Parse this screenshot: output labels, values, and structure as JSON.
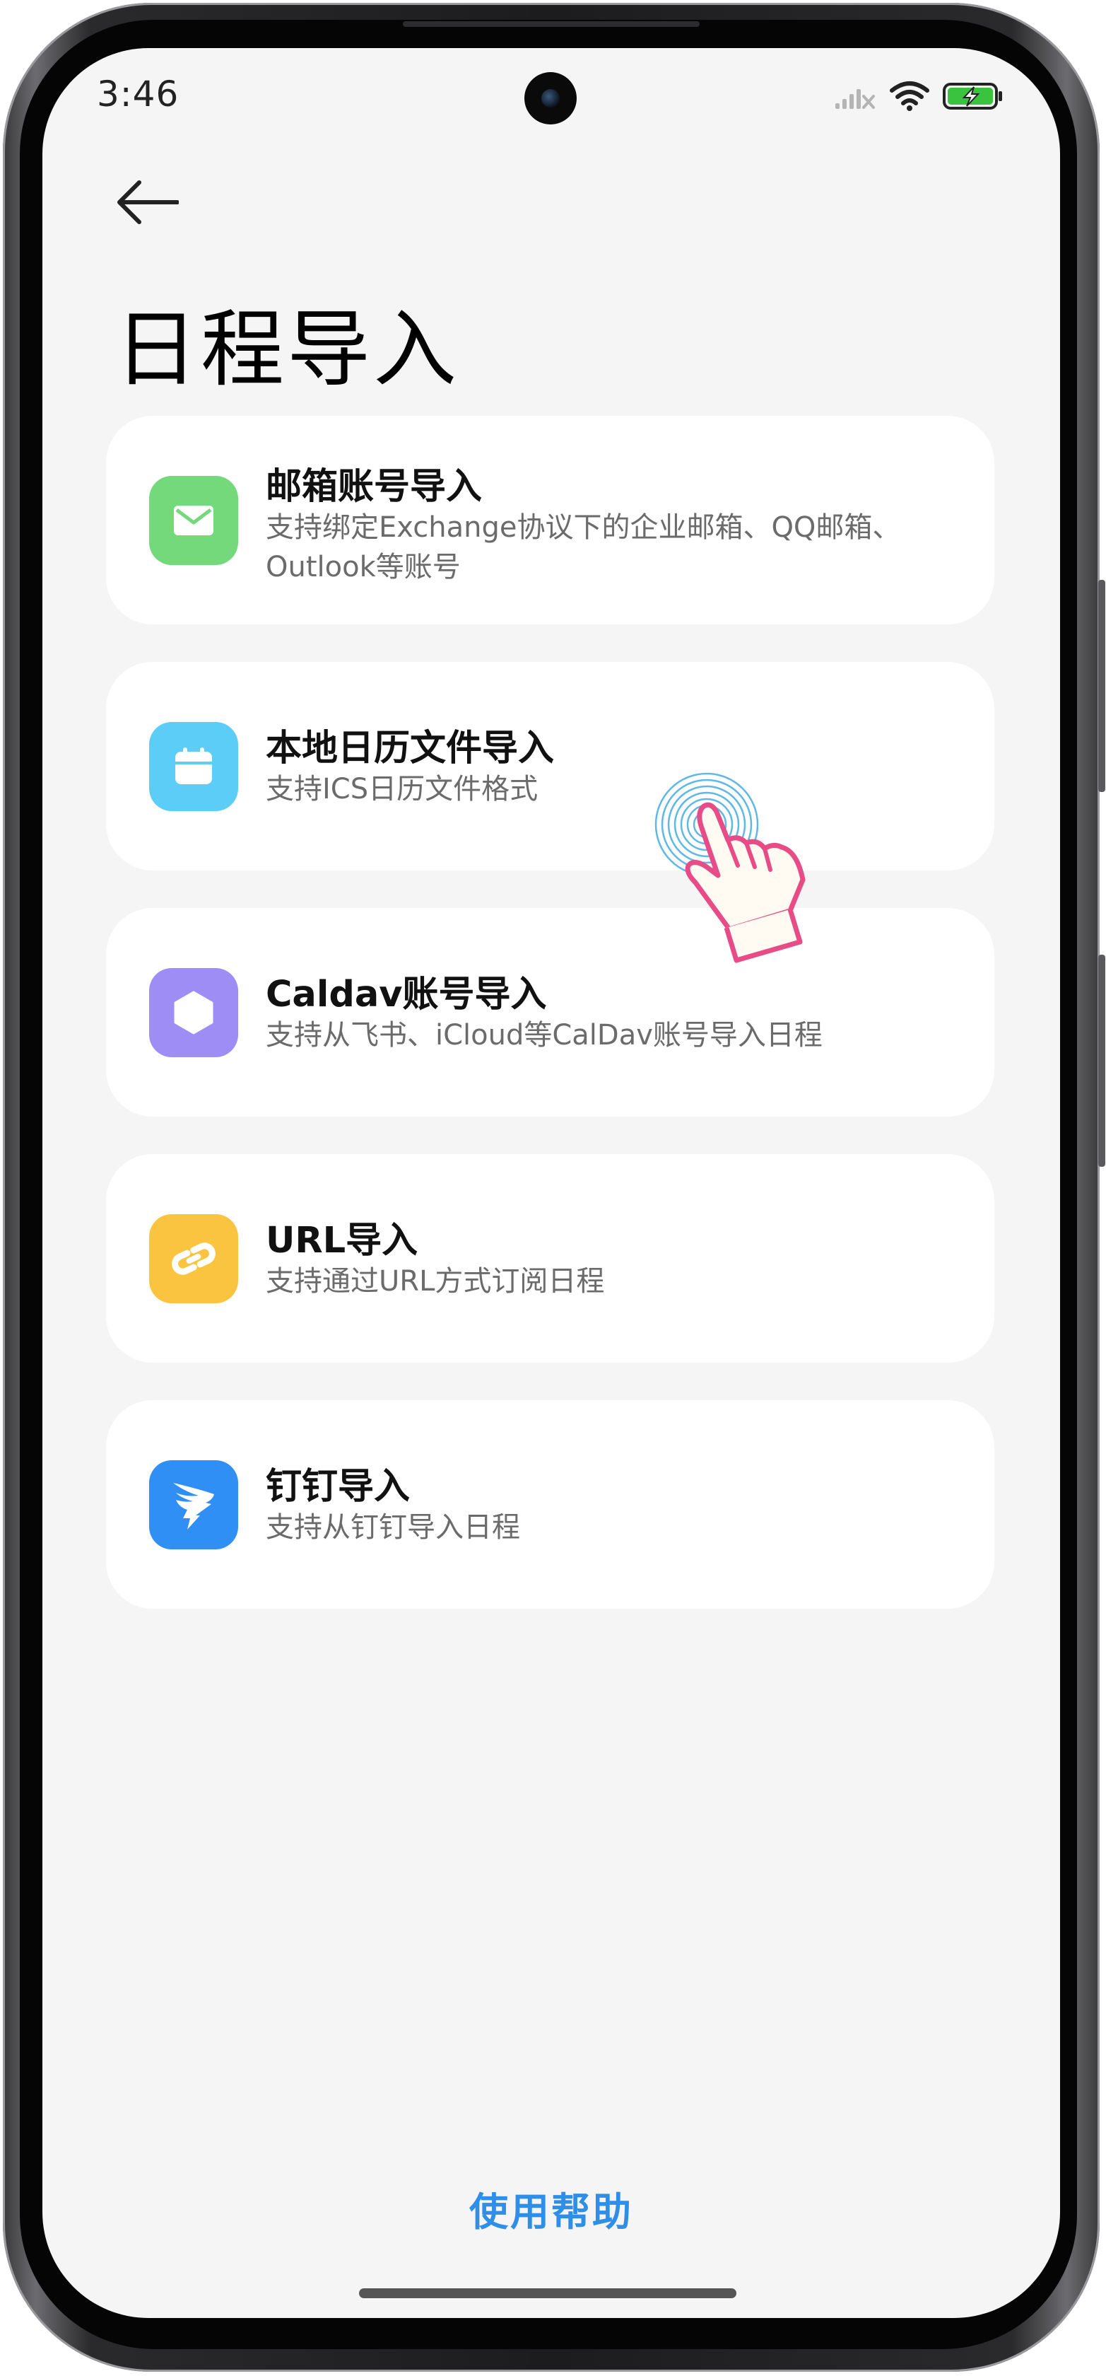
{
  "status_bar": {
    "time": "3:46"
  },
  "header": {
    "back_icon": "arrow-left-icon",
    "title": "日程导入"
  },
  "import_options": [
    {
      "title": "邮箱账号导入",
      "description": "支持绑定Exchange协议下的企业邮箱、QQ邮箱、Outlook等账号",
      "icon": "mail-icon",
      "icon_color": "#74d97a"
    },
    {
      "title": "本地日历文件导入",
      "description": "支持ICS日历文件格式",
      "icon": "calendar-icon",
      "icon_color": "#5bcdf7"
    },
    {
      "title": "Caldav账号导入",
      "description": "支持从飞书、iCloud等CalDav账号导入日程",
      "icon": "hexagon-icon",
      "icon_color": "#9d8df5"
    },
    {
      "title": "URL导入",
      "description": "支持通过URL方式订阅日程",
      "icon": "link-icon",
      "icon_color": "#fbc440"
    },
    {
      "title": "钉钉导入",
      "description": "支持从钉钉导入日程",
      "icon": "dingtalk-icon",
      "icon_color": "#2f8ff5"
    }
  ],
  "footer": {
    "help_label": "使用帮助",
    "help_color": "#2f8fe8"
  }
}
